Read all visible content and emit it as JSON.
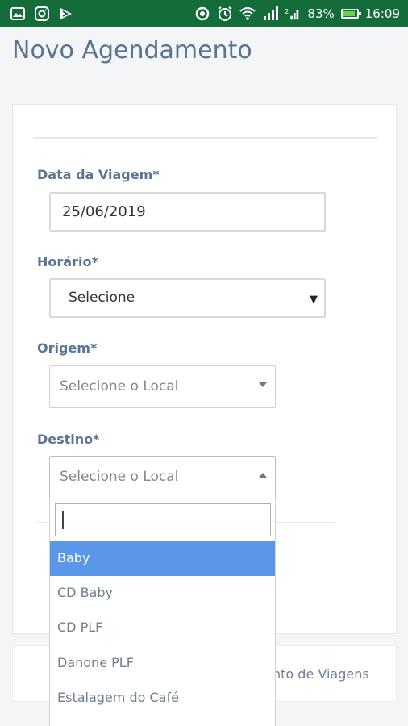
{
  "status_bar": {
    "battery": "83%",
    "time": "16:09",
    "icons_left": [
      "gallery-icon",
      "instagram-icon",
      "flag-icon"
    ],
    "icons_right": [
      "sync-icon",
      "alarm-icon",
      "wifi-icon",
      "signal-icon",
      "sim2-signal-icon",
      "battery-icon"
    ]
  },
  "page": {
    "title": "Novo Agendamento"
  },
  "form": {
    "data_label": "Data da Viagem*",
    "data_value": "25/06/2019",
    "horario_label": "Horário*",
    "horario_value": "Selecione",
    "origem_label": "Origem*",
    "origem_placeholder": "Selecione o Local",
    "destino_label": "Destino*",
    "destino_placeholder": "Selecione o Local"
  },
  "dropdown": {
    "search_value": "",
    "options": [
      "Baby",
      "CD Baby",
      "CD PLF",
      "Danone PLF",
      "Estalagem do Café"
    ],
    "highlighted": "Baby"
  },
  "bottom": {
    "text_visible": "nto de Viagens"
  },
  "colors": {
    "status_bar": "#146c3a",
    "title": "#5a7491",
    "highlight": "#5b97e9"
  }
}
